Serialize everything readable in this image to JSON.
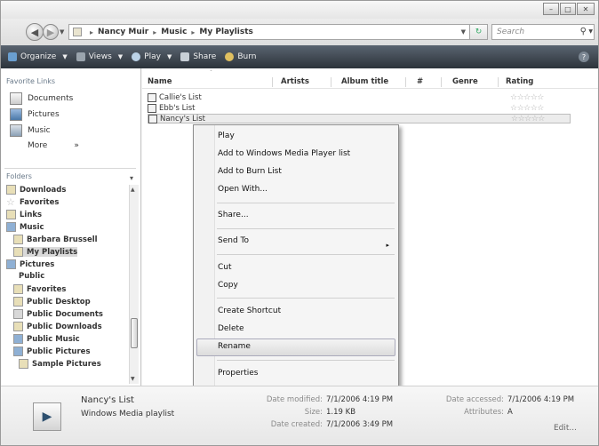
{
  "address": {
    "crumbs": [
      "Nancy Muir",
      "Music",
      "My Playlists"
    ],
    "separator": "▸",
    "refresh_glyph": "↻",
    "search_placeholder": "Search"
  },
  "toolbar": {
    "organize": "Organize",
    "views": "Views",
    "play": "Play",
    "share": "Share",
    "burn": "Burn",
    "help": "?"
  },
  "nav": {
    "favorites_title": "Favorite Links",
    "favorites": [
      {
        "label": "Documents",
        "icon": "documents-icon"
      },
      {
        "label": "Pictures",
        "icon": "pictures-icon"
      },
      {
        "label": "Music",
        "icon": "music-icon"
      }
    ],
    "more": "More",
    "more_glyph": "»",
    "folders_title": "Folders",
    "tree": [
      {
        "label": "Downloads",
        "icon": "folder-icon"
      },
      {
        "label": "Favorites",
        "icon": "star-icon"
      },
      {
        "label": "Links",
        "icon": "folder-icon"
      },
      {
        "label": "Music",
        "icon": "music-folder-icon"
      },
      {
        "label": "Barbara Brussell",
        "icon": "folder-icon"
      },
      {
        "label": "My Playlists",
        "icon": "folder-icon",
        "selected": true
      },
      {
        "label": "Pictures",
        "icon": "pictures-folder-icon"
      },
      {
        "label": "Public",
        "icon": "none"
      },
      {
        "label": "Favorites",
        "icon": "folder-icon"
      },
      {
        "label": "Public Desktop",
        "icon": "folder-icon"
      },
      {
        "label": "Public Documents",
        "icon": "folder-icon"
      },
      {
        "label": "Public Downloads",
        "icon": "folder-icon"
      },
      {
        "label": "Public Music",
        "icon": "music-folder-icon"
      },
      {
        "label": "Public Pictures",
        "icon": "pictures-folder-icon"
      },
      {
        "label": "Sample Pictures",
        "icon": "folder-icon"
      }
    ]
  },
  "filelist": {
    "columns": [
      "Name",
      "Artists",
      "Album title",
      "#",
      "Genre",
      "Rating"
    ],
    "rows": [
      {
        "name": "Callie's List",
        "rating": 0
      },
      {
        "name": "Ebb's List",
        "rating": 0
      },
      {
        "name": "Nancy's List",
        "rating": 0,
        "selected": true
      }
    ],
    "stars": "☆☆☆☆☆"
  },
  "context_menu": {
    "items": [
      "Play",
      "Add to Windows Media Player list",
      "Add to Burn List",
      "Open With...",
      "Share...",
      "Send To",
      "Cut",
      "Copy",
      "Create Shortcut",
      "Delete",
      "Rename",
      "Properties"
    ],
    "highlighted": "Rename",
    "submenu_arrow": "▸"
  },
  "details": {
    "name": "Nancy's List",
    "type": "Windows Media playlist",
    "modified_label": "Date modified:",
    "modified_value": "7/1/2006 4:19 PM",
    "size_label": "Size:",
    "size_value": "1.19 KB",
    "created_label": "Date created:",
    "created_value": "7/1/2006 3:49 PM",
    "accessed_label": "Date accessed:",
    "accessed_value": "7/1/2006 4:19 PM",
    "attributes_label": "Attributes:",
    "attributes_value": "A",
    "edit": "Edit..."
  },
  "colors": {
    "toolbar_bg": "#3a424c",
    "context_highlight": "#dcdcdc",
    "selected_row": "#ececec"
  }
}
